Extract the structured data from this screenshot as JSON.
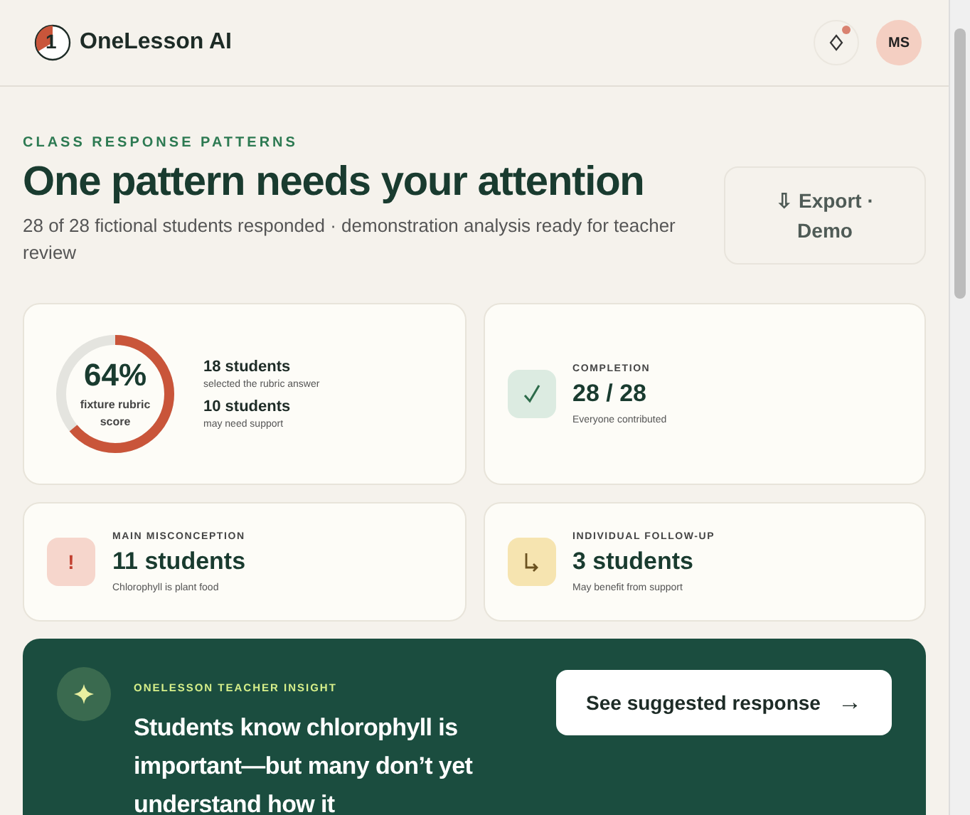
{
  "brand": {
    "logo_mark": "1",
    "name": "OneLesson AI"
  },
  "header": {
    "notification_dot": true,
    "avatar": "MS"
  },
  "eyebrow": "CLASS RESPONSE PATTERNS",
  "title": "One pattern needs your attention",
  "subtitle": "28 of 28 fictional students responded · demonstration analysis ready for teacher review",
  "export_button": "⇩ Export · Demo",
  "score_card": {
    "value": "64%",
    "caption": "fixture rubric score",
    "level": 0.64,
    "stats": [
      {
        "count": "18 students",
        "note": "selected the rubric answer"
      },
      {
        "count": "10 students",
        "note": "may need support"
      }
    ]
  },
  "cards": [
    {
      "kind": "check",
      "label": "COMPLETION",
      "value": "28 / 28",
      "note": "Everyone contributed"
    },
    {
      "kind": "alert",
      "icon": "!",
      "label": "MAIN MISCONCEPTION",
      "value": "11 students",
      "note": "Chlorophyll is plant food"
    },
    {
      "kind": "followup",
      "label": "INDIVIDUAL FOLLOW-UP",
      "value": "3 students",
      "note": "May benefit from support"
    }
  ],
  "insight": {
    "label": "ONELESSON TEACHER INSIGHT",
    "text": "Students know chlorophyll is important—but many don’t yet understand how it",
    "button": "See suggested response",
    "button_arrow": "→"
  }
}
